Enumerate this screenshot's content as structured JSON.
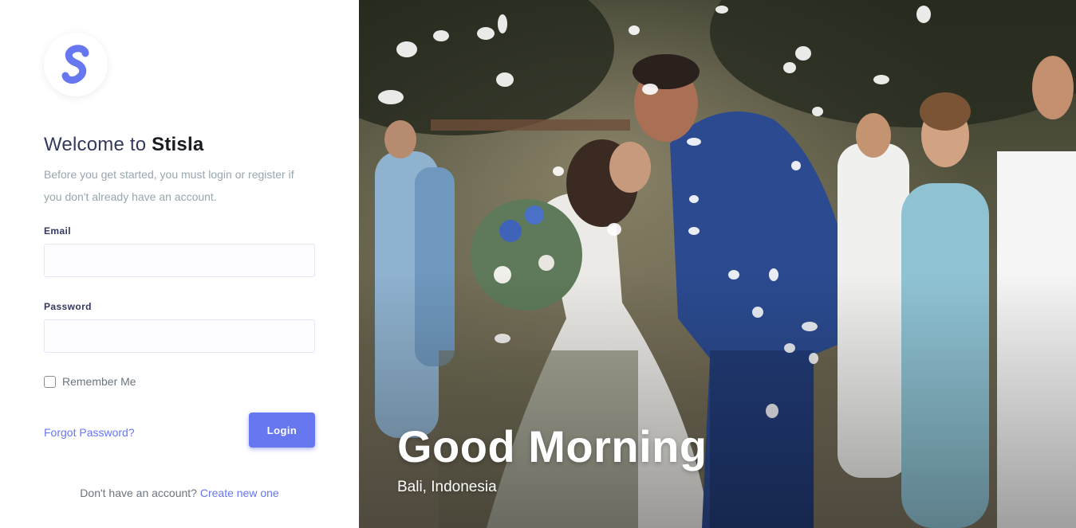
{
  "brand": {
    "logo_letter": "S",
    "accent_color": "#6777ef"
  },
  "welcome": {
    "prefix": "Welcome to",
    "brand_name": "Stisla",
    "intro": "Before you get started, you must login or register if you don't already have an account."
  },
  "form": {
    "email_label": "Email",
    "email_value": "",
    "password_label": "Password",
    "password_value": "",
    "remember_label": "Remember Me",
    "remember_checked": false,
    "forgot_label": "Forgot Password?",
    "login_label": "Login"
  },
  "register": {
    "prompt": "Don't have an account?",
    "link_label": "Create new one"
  },
  "hero": {
    "greeting": "Good Morning",
    "location": "Bali, Indonesia"
  }
}
